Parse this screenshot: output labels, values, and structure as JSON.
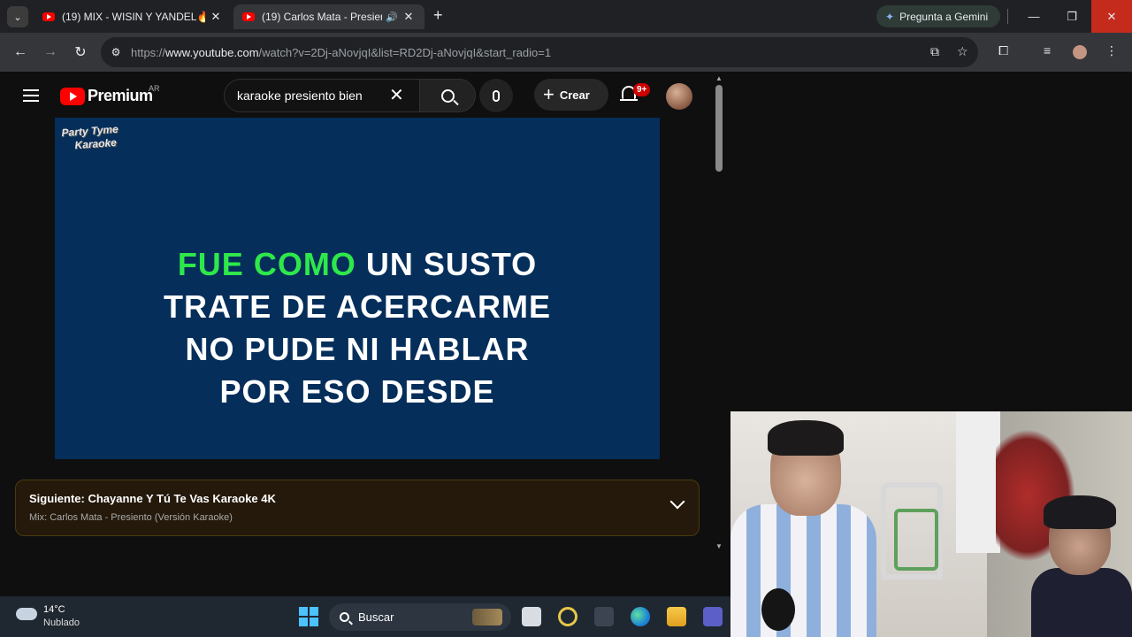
{
  "browser": {
    "tabs": [
      {
        "title": "(19) MIX - WISIN Y YANDEL🔥(",
        "active": false
      },
      {
        "title": "(19) Carlos Mata - Presiento",
        "active": true
      }
    ],
    "gemini_label": "Pregunta a Gemini",
    "url_prefix": "https://",
    "url_host": "www.youtube.com",
    "url_rest": "/watch?v=2Dj-aNovjqI&list=RD2Dj-aNovjqI&start_radio=1"
  },
  "youtube": {
    "logo_text": "Premium",
    "country": "AR",
    "search_value": "karaoke presiento bien",
    "create_label": "Crear",
    "notif_badge": "9+",
    "video": {
      "brand": [
        "Party Tyme",
        "Karaoke"
      ],
      "lyrics": [
        {
          "sung": "FUE COMO",
          "rest": " UN SUSTO"
        },
        {
          "sung": "",
          "rest": "TRATE DE ACERCARME"
        },
        {
          "sung": "",
          "rest": "NO PUDE NI HABLAR"
        },
        {
          "sung": "",
          "rest": "POR ESO DESDE"
        }
      ],
      "sung_color": "#2ee84b"
    },
    "up_next": {
      "title": "Siguiente: Chayanne Y Tú Te Vas Karaoke 4K",
      "subtitle": "Mix: Carlos Mata - Presiento (Versión Karaoke)"
    }
  },
  "taskbar": {
    "temp": "14°C",
    "weather": "Nublado",
    "search_label": "Buscar"
  }
}
